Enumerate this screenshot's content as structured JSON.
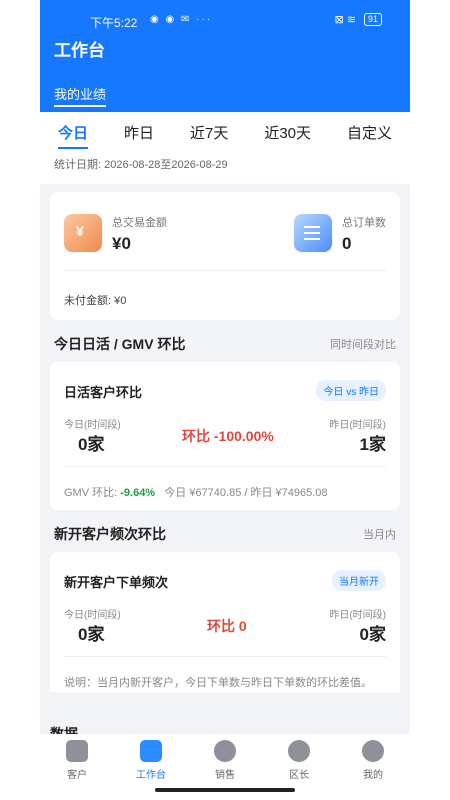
{
  "status_bar": {
    "time": "下午5:22",
    "left_icons": "◉ ◉ ✉ ···",
    "right_icons": "⊠ ≋",
    "battery": "91"
  },
  "header": {
    "title": "工作台",
    "sub_tab": "我的业绩"
  },
  "date_tabs": [
    {
      "label": "今日",
      "active": true
    },
    {
      "label": "昨日",
      "active": false
    },
    {
      "label": "近7天",
      "active": false
    },
    {
      "label": "近30天",
      "active": false
    },
    {
      "label": "自定义",
      "active": false
    }
  ],
  "date_range": "统计日期: 2026-08-28至2026-08-29",
  "summary": {
    "total_amount_label": "总交易金额",
    "total_amount_value": "¥0",
    "total_orders_label": "总订单数",
    "total_orders_value": "0",
    "unpaid": "未付金额: ¥0",
    "money_icon_glyph": "¥"
  },
  "daily_active": {
    "section_title": "今日日活 / GMV 环比",
    "section_right": "同时间段对比",
    "card_title": "日活客户环比",
    "badge": "今日 vs 昨日",
    "today_label": "今日(时间段)",
    "today_value": "0家",
    "ratio": "环比 -100.00%",
    "yesterday_label": "昨日(时间段)",
    "yesterday_value": "1家",
    "gmv_prefix": "GMV 环比: ",
    "gmv_pct": "-9.64%",
    "gmv_detail": "今日 ¥67740.85 / 昨日 ¥74965.08"
  },
  "new_customers": {
    "section_title": "新开客户频次环比",
    "section_right": "当月内",
    "card_title": "新开客户下单频次",
    "badge": "当月新开",
    "today_label": "今日(时间段)",
    "today_value": "0家",
    "ratio": "环比 0",
    "yesterday_label": "昨日(时间段)",
    "yesterday_value": "0家",
    "note": "说明：当月内新开客户，今日下单数与昨日下单数的环比差值。"
  },
  "peek_text": "数据",
  "bottom_nav": [
    {
      "label": "客户",
      "icon": "store-icon",
      "active": false
    },
    {
      "label": "工作台",
      "icon": "cube-icon",
      "active": true
    },
    {
      "label": "销售",
      "icon": "users-icon",
      "active": false
    },
    {
      "label": "区长",
      "icon": "manager-icon",
      "active": false
    },
    {
      "label": "我的",
      "icon": "profile-icon",
      "active": false
    }
  ],
  "colors": {
    "brand": "#1677ff",
    "negative": "#e0483b",
    "positive": "#1f9d45"
  }
}
